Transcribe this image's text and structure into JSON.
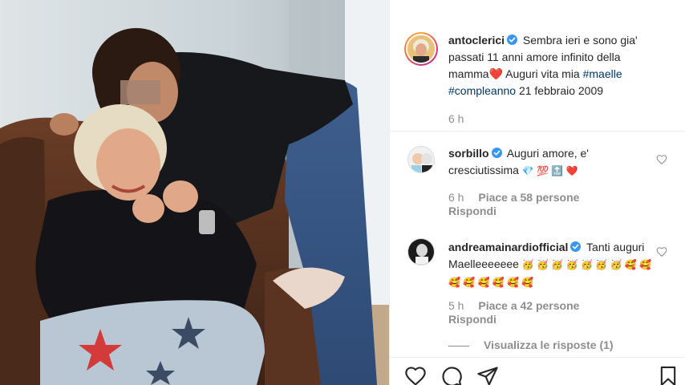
{
  "post": {
    "username": "antoclerici",
    "caption": "Sembra ieri e sono gia' passati 11 anni amore infinito della mamma",
    "caption_emoji": "❤️",
    "caption_tail": "Auguri vita mia",
    "hashtag_1": "#maelle",
    "hashtag_2": "#compleanno",
    "caption_end": "21 febbraio 2009",
    "time": "6 h"
  },
  "comments": [
    {
      "username": "sorbillo",
      "text": "Auguri amore, e' cresciutissima",
      "emojis": "💎 💯 🔝 ❤️",
      "time": "6 h",
      "likes": "Piace a 58 persone",
      "reply": "Rispondi"
    },
    {
      "username": "andreamainardiofficial",
      "text": "Tanti auguri Maelleeeeeee",
      "emojis": "🥳 🥳 🥳 🥳 🥳 🥳 🥳 🥰 🥰 🥰 🥰 🥰 🥰 🥰 🥰",
      "time": "5 h",
      "likes": "Piace a 42 persone",
      "reply": "Rispondi"
    }
  ],
  "view_replies": "Visualizza le risposte (1)",
  "icons": {
    "verified": "verified-badge-icon",
    "like": "heart-icon",
    "comment": "comment-icon",
    "share": "share-icon",
    "save": "bookmark-icon"
  },
  "colors": {
    "verified": "#3897f0",
    "hashtag": "#00376b",
    "meta": "#8e8e8e",
    "heart": "#ed4956"
  }
}
